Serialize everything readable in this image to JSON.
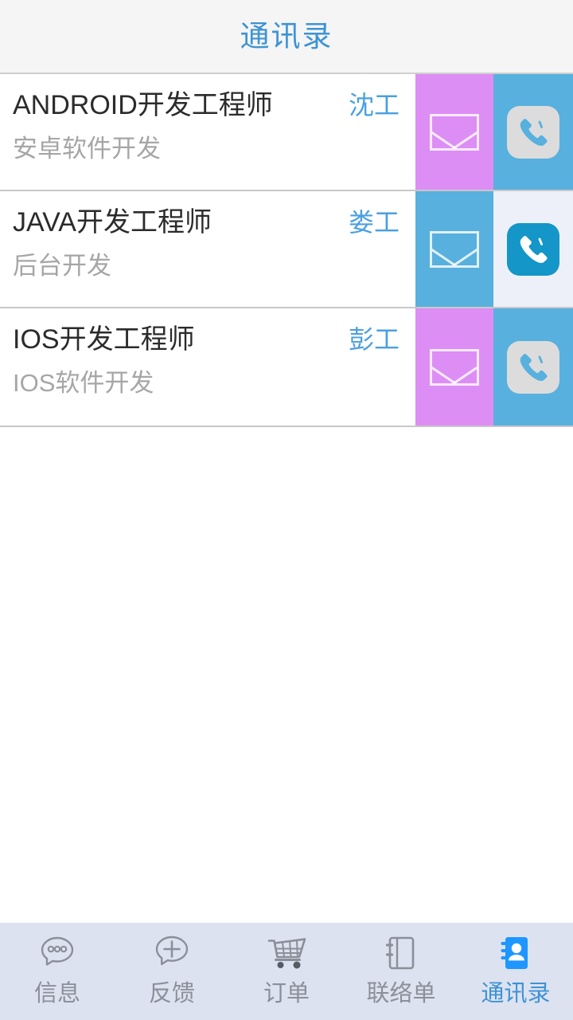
{
  "header": {
    "title": "通讯录"
  },
  "colors": {
    "accent_blue": "#3d93d4",
    "panel_purple": "#dd8ef5",
    "panel_blue": "#58b0de",
    "panel_light": "#edf0f8",
    "tile_light": "#dcdcdc",
    "tile_blue": "#1496c8",
    "header_bg": "#f5f5f5",
    "tabbar_bg": "#dde2f0",
    "title_text": "#2b2b2b",
    "sub_text": "#a6a6a6",
    "tab_label": "#8a8f99"
  },
  "contacts": [
    {
      "title": "ANDROID开发工程师",
      "person": "沈工",
      "subtitle": "安卓软件开发",
      "mail_bg": "#dd8ef5",
      "call_bg": "#58b0de",
      "call_tile_bg": "#dcdcdc",
      "call_glyph": "#58b0de",
      "mail_action": "发邮件",
      "call_action": "打电话"
    },
    {
      "title": "JAVA开发工程师",
      "person": "娄工",
      "subtitle": "后台开发",
      "mail_bg": "#58b0de",
      "call_bg": "#edf0f8",
      "call_tile_bg": "#1496c8",
      "call_glyph": "#ffffff",
      "mail_action": "发邮件",
      "call_action": "打电话"
    },
    {
      "title": "IOS开发工程师",
      "person": "彭工",
      "subtitle": "IOS软件开发",
      "mail_bg": "#dd8ef5",
      "call_bg": "#58b0de",
      "call_tile_bg": "#dcdcdc",
      "call_glyph": "#58b0de",
      "mail_action": "发邮件",
      "call_action": "打电话"
    }
  ],
  "tabbar": {
    "items": [
      {
        "label": "信息",
        "icon": "message-bubble-icon",
        "active": false
      },
      {
        "label": "反馈",
        "icon": "feedback-plus-bubble-icon",
        "active": false
      },
      {
        "label": "订单",
        "icon": "shopping-cart-icon",
        "active": false
      },
      {
        "label": "联络单",
        "icon": "notebook-icon",
        "active": false
      },
      {
        "label": "通讯录",
        "icon": "contacts-book-icon",
        "active": true
      }
    ]
  }
}
